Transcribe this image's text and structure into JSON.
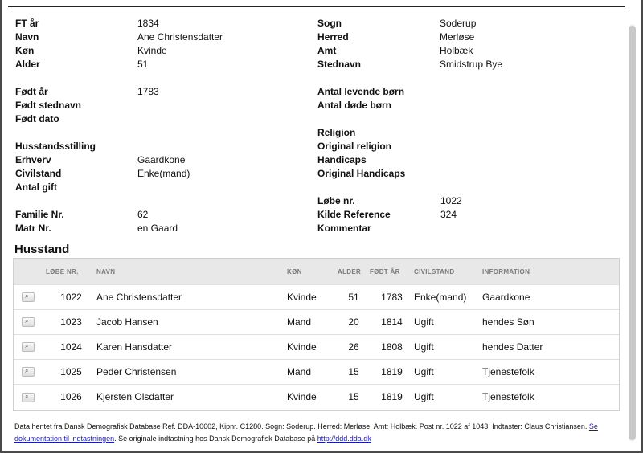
{
  "info": {
    "ft_aar": {
      "label": "FT år",
      "value": "1834"
    },
    "navn": {
      "label": "Navn",
      "value": "Ane Christensdatter"
    },
    "koen": {
      "label": "Køn",
      "value": "Kvinde"
    },
    "alder": {
      "label": "Alder",
      "value": "51"
    },
    "foedt_aar": {
      "label": "Født år",
      "value": "1783"
    },
    "foedt_stednavn": {
      "label": "Født stednavn",
      "value": ""
    },
    "foedt_dato": {
      "label": "Født dato",
      "value": ""
    },
    "husstandsstilling": {
      "label": "Husstandsstilling",
      "value": ""
    },
    "erhverv": {
      "label": "Erhverv",
      "value": "Gaardkone"
    },
    "civilstand": {
      "label": "Civilstand",
      "value": "Enke(mand)"
    },
    "antal_gift": {
      "label": "Antal gift",
      "value": ""
    },
    "familie_nr": {
      "label": "Familie Nr.",
      "value": "62"
    },
    "matr_nr": {
      "label": "Matr Nr.",
      "value": "en Gaard"
    },
    "sogn": {
      "label": "Sogn",
      "value": "Soderup"
    },
    "herred": {
      "label": "Herred",
      "value": "Merløse"
    },
    "amt": {
      "label": "Amt",
      "value": "Holbæk"
    },
    "stednavn": {
      "label": "Stednavn",
      "value": "Smidstrup Bye"
    },
    "antal_levende_boern": {
      "label": "Antal levende børn",
      "value": ""
    },
    "antal_doede_boern": {
      "label": "Antal døde børn",
      "value": ""
    },
    "religion": {
      "label": "Religion",
      "value": ""
    },
    "original_religion": {
      "label": "Original religion",
      "value": ""
    },
    "handicaps": {
      "label": "Handicaps",
      "value": ""
    },
    "original_handicaps": {
      "label": "Original Handicaps",
      "value": ""
    },
    "loebe_nr": {
      "label": "Løbe nr.",
      "value": "1022"
    },
    "kilde_reference": {
      "label": "Kilde Reference",
      "value": "324"
    },
    "kommentar": {
      "label": "Kommentar",
      "value": ""
    }
  },
  "household": {
    "title": "Husstand",
    "columns": {
      "loebe_nr": "LØBE NR.",
      "navn": "NAVN",
      "koen": "KØN",
      "alder": "ALDER",
      "foedt_aar": "FØDT ÅR",
      "civilstand": "CIVILSTAND",
      "information": "INFORMATION"
    },
    "rows": [
      {
        "loebe_nr": "1022",
        "navn": "Ane Christensdatter",
        "koen": "Kvinde",
        "alder": "51",
        "foedt_aar": "1783",
        "civilstand": "Enke(mand)",
        "information": "Gaardkone"
      },
      {
        "loebe_nr": "1023",
        "navn": "Jacob Hansen",
        "koen": "Mand",
        "alder": "20",
        "foedt_aar": "1814",
        "civilstand": "Ugift",
        "information": "hendes Søn"
      },
      {
        "loebe_nr": "1024",
        "navn": "Karen Hansdatter",
        "koen": "Kvinde",
        "alder": "26",
        "foedt_aar": "1808",
        "civilstand": "Ugift",
        "information": "hendes Datter"
      },
      {
        "loebe_nr": "1025",
        "navn": "Peder Christensen",
        "koen": "Mand",
        "alder": "15",
        "foedt_aar": "1819",
        "civilstand": "Ugift",
        "information": "Tjenestefolk"
      },
      {
        "loebe_nr": "1026",
        "navn": "Kjersten Olsdatter",
        "koen": "Kvinde",
        "alder": "15",
        "foedt_aar": "1819",
        "civilstand": "Ugift",
        "information": "Tjenestefolk"
      }
    ],
    "row_icon": "magnifier-icon"
  },
  "footer": {
    "text1": "Data hentet fra Dansk Demografisk Database Ref. DDA-10602, Kipnr. C1280. Sogn: Soderup. Herred: Merløse. Amt: Holbæk. Post nr. 1022 af 1043. Indtaster: Claus Christiansen. ",
    "link1": "Se dokumentation til indtastningen",
    "text2": ". Se originale indtastning hos Dansk Demografisk Database på ",
    "link2": "http://ddd.dda.dk"
  },
  "colors": {
    "link": "#1a1aa6",
    "table_header_bg": "#e8e8e8",
    "header_text": "#7a7a7a"
  }
}
